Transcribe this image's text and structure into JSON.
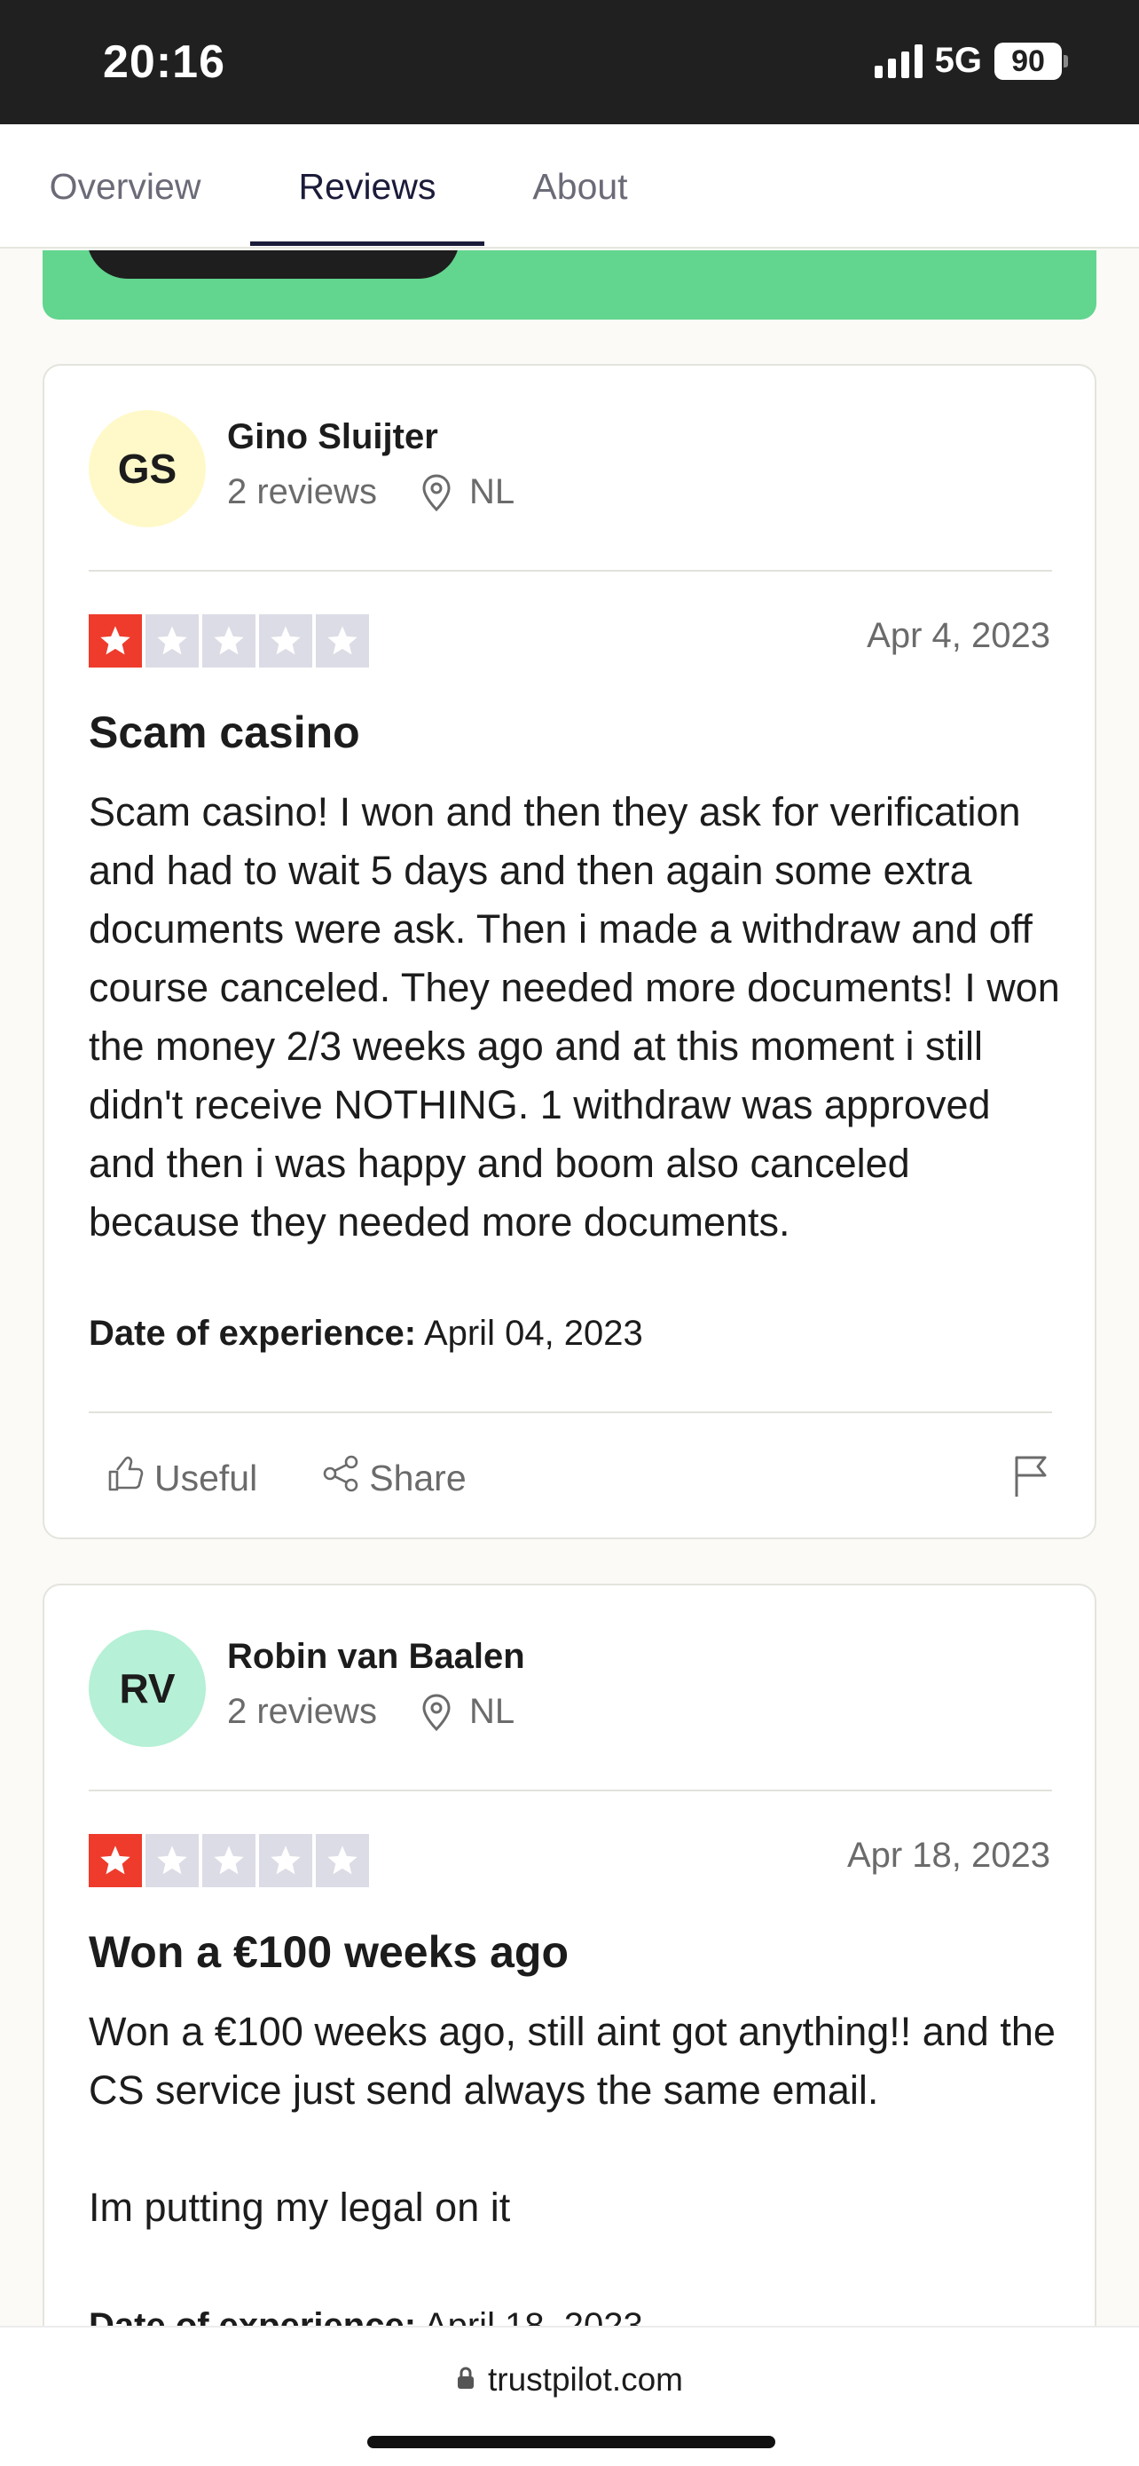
{
  "status_bar": {
    "time": "20:16",
    "network": "5G",
    "battery": "90"
  },
  "tabs": [
    {
      "label": "Overview",
      "active": false
    },
    {
      "label": "Reviews",
      "active": true
    },
    {
      "label": "About",
      "active": false
    }
  ],
  "reviews": [
    {
      "initials": "GS",
      "avatar_color": "#fff9c9",
      "name": "Gino Sluijter",
      "review_count": "2 reviews",
      "country": "NL",
      "rating": 1,
      "date": "Apr 4, 2023",
      "title": "Scam casino",
      "body": "Scam casino! I won and then they ask for verification and had to wait 5 days and then again some extra documents were ask. Then i made a withdraw and off course canceled. They needed more documents! I won the money 2/3 weeks ago and at this moment i still didn't receive NOTHING. 1 withdraw was approved and then i was happy and boom also canceled because they needed more documents.",
      "experience_label": "Date of experience:",
      "experience_date": "April 04, 2023",
      "useful_label": "Useful",
      "share_label": "Share"
    },
    {
      "initials": "RV",
      "avatar_color": "#b6f0d6",
      "name": "Robin van Baalen",
      "review_count": "2 reviews",
      "country": "NL",
      "rating": 1,
      "date": "Apr 18, 2023",
      "title": "Won a €100 weeks ago",
      "body": "Won a €100 weeks ago, still aint got anything!! and the CS service just send always the same email.\n\nIm putting my legal on it",
      "experience_label": "Date of experience:",
      "experience_date": "April 18, 2023"
    }
  ],
  "browser": {
    "url": "trustpilot.com"
  },
  "colors": {
    "star_filled": "#ee3b2c",
    "star_empty": "#dcdce6",
    "banner_green": "#62d58e"
  }
}
